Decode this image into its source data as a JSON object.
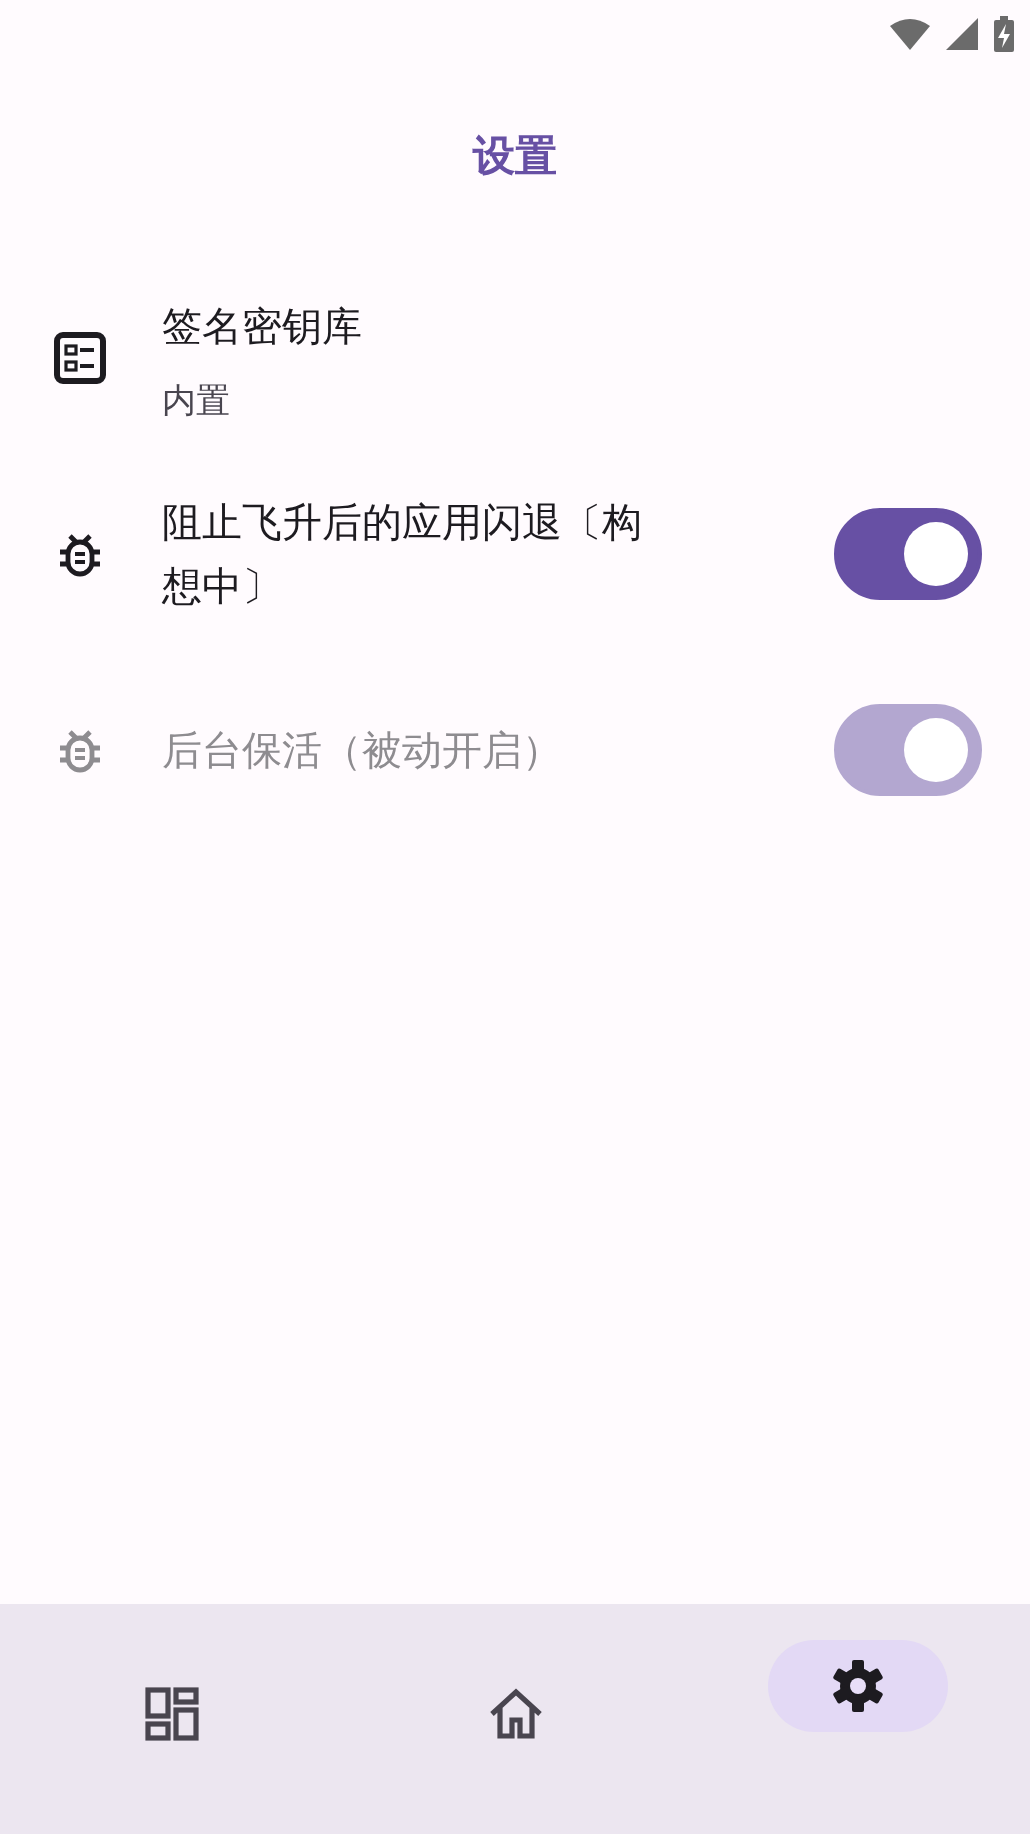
{
  "title": "设置",
  "settings": [
    {
      "kind": "info",
      "title": "签名密钥库",
      "subtitle": "内置"
    },
    {
      "kind": "switch",
      "title": "阻止飞升后的应用闪退〔构想中〕",
      "on": true,
      "disabled": false
    },
    {
      "kind": "switch",
      "title": "后台保活（被动开启）",
      "on": true,
      "disabled": true
    }
  ],
  "nav": [
    {
      "selected": false
    },
    {
      "selected": false
    },
    {
      "selected": true
    }
  ]
}
